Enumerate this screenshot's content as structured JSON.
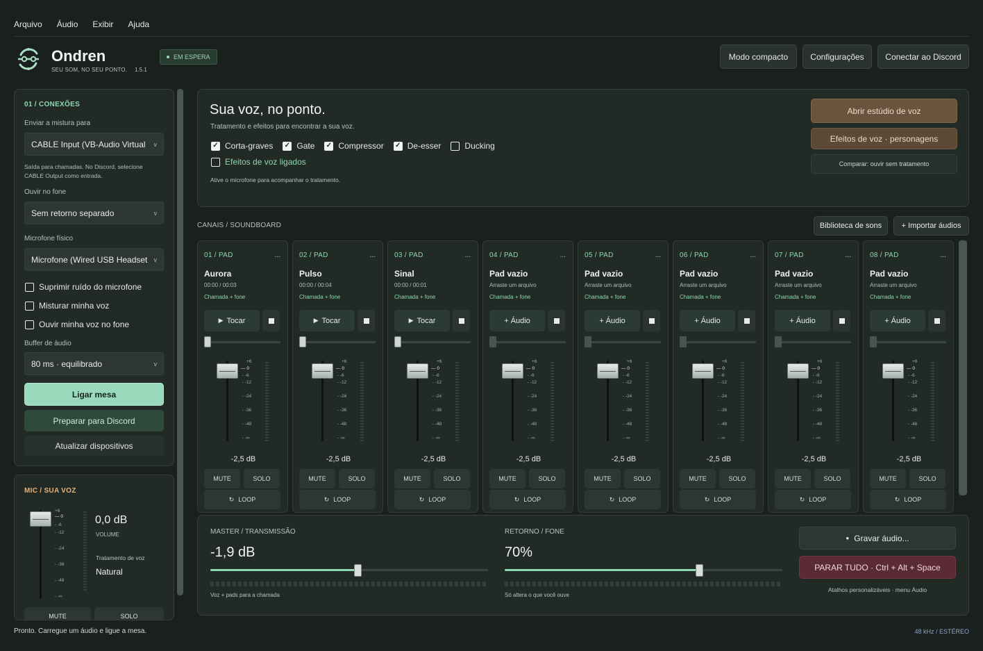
{
  "menu": [
    "Arquivo",
    "Áudio",
    "Exibir",
    "Ajuda"
  ],
  "app": {
    "name": "Ondren",
    "tagline": "SEU SOM, NO SEU PONTO.",
    "version": "1.5.1",
    "status": "EM ESPERA"
  },
  "header_buttons": {
    "compact": "Modo compacto",
    "settings": "Configurações",
    "discord": "Conectar ao Discord"
  },
  "connections": {
    "title": "01 / CONEXÕES",
    "send_label": "Enviar a mistura para",
    "send_value": "CABLE Input (VB-Audio Virtual (",
    "send_note_1": "Saída para chamadas. No Discord, selecione",
    "send_note_2": "CABLE Output como entrada.",
    "monitor_label": "Ouvir no fone",
    "monitor_value": "Sem retorno separado",
    "mic_label": "Microfone físico",
    "mic_value": "Microfone (Wired USB Headset",
    "options": [
      "Suprimir ruído do microfone",
      "Misturar minha voz",
      "Ouvir minha voz no fone"
    ],
    "buffer_label": "Buffer de áudio",
    "buffer_value": "80 ms · equilibrado",
    "start": "Ligar mesa",
    "prepare": "Preparar para Discord",
    "refresh": "Atualizar dispositivos"
  },
  "mic": {
    "title": "MIC / SUA VOZ",
    "db": "0,0 dB",
    "volume_label": "VOLUME",
    "treatment_label": "Tratamento de voz",
    "treatment_value": "Natural",
    "mute": "MUTE",
    "solo": "SOLO",
    "scale": [
      "+6",
      "0",
      "-6",
      "-12",
      "-24",
      "-36",
      "-48",
      "-∞"
    ]
  },
  "voice": {
    "title": "Sua voz, no ponto.",
    "subtitle": "Tratamento e efeitos para encontrar a sua voz.",
    "effects": [
      {
        "label": "Corta-graves",
        "checked": true
      },
      {
        "label": "Gate",
        "checked": true
      },
      {
        "label": "Compressor",
        "checked": true
      },
      {
        "label": "De-esser",
        "checked": true
      },
      {
        "label": "Ducking",
        "checked": false
      }
    ],
    "fx_toggle": "Efeitos de voz ligados",
    "hint": "Ative o microfone para acompanhar o tratamento.",
    "studio": "Abrir estúdio de voz",
    "characters": "Efeitos de voz · personagens",
    "compare": "Comparar: ouvir sem tratamento"
  },
  "channels": {
    "title": "CANAIS / SOUNDBOARD",
    "library": "Biblioteca de sons",
    "import": "+ Importar áudios",
    "scale": [
      "+6",
      "0",
      "-6",
      "-12",
      "-24",
      "-36",
      "-48",
      "-∞"
    ],
    "pads": [
      {
        "num": "01  /  PAD",
        "name": "Aurora",
        "time": "00:00 / 00:03",
        "route": "Chamada + fone",
        "action": "Tocar",
        "db": "-2,5 dB",
        "empty": false
      },
      {
        "num": "02  /  PAD",
        "name": "Pulso",
        "time": "00:00 / 00:04",
        "route": "Chamada + fone",
        "action": "Tocar",
        "db": "-2,5 dB",
        "empty": false
      },
      {
        "num": "03  /  PAD",
        "name": "Sinal",
        "time": "00:00 / 00:01",
        "route": "Chamada + fone",
        "action": "Tocar",
        "db": "-2,5 dB",
        "empty": false
      },
      {
        "num": "04  /  PAD",
        "name": "Pad vazio",
        "time": "Arraste um arquivo",
        "route": "Chamada + fone",
        "action": "+ Áudio",
        "db": "-2,5 dB",
        "empty": true
      },
      {
        "num": "05  /  PAD",
        "name": "Pad vazio",
        "time": "Arraste um arquivo",
        "route": "Chamada + fone",
        "action": "+ Áudio",
        "db": "-2,5 dB",
        "empty": true
      },
      {
        "num": "06  /  PAD",
        "name": "Pad vazio",
        "time": "Arraste um arquivo",
        "route": "Chamada + fone",
        "action": "+ Áudio",
        "db": "-2,5 dB",
        "empty": true
      },
      {
        "num": "07  /  PAD",
        "name": "Pad vazio",
        "time": "Arraste um arquivo",
        "route": "Chamada + fone",
        "action": "+ Áudio",
        "db": "-2,5 dB",
        "empty": true
      },
      {
        "num": "08  /  PAD",
        "name": "Pad vazio",
        "time": "Arraste um arquivo",
        "route": "Chamada + fone",
        "action": "+ Áudio",
        "db": "-2,5 dB",
        "empty": true
      }
    ],
    "mute": "MUTE",
    "solo": "SOLO",
    "loop": "LOOP",
    "dots": "..."
  },
  "master": {
    "label": "MASTER / TRANSMISSÃO",
    "value": "-1,9 dB",
    "level": 0.53,
    "note": "Voz + pads para a chamada"
  },
  "monitor": {
    "label": "RETORNO / FONE",
    "value": "70%",
    "level": 0.7,
    "note": "Só altera o que você ouve"
  },
  "actions": {
    "record": "Gravar áudio...",
    "stop_all": "PARAR TUDO · Ctrl + Alt + Space",
    "shortcuts": "Atalhos personalizáveis · menu Áudio"
  },
  "statusbar": {
    "message": "Pronto. Carregue um áudio e ligue a mesa.",
    "format": "48 kHz / ESTÉREO"
  },
  "colors": {
    "accent": "#8fd6b3",
    "background": "#1a201d",
    "panel": "#222a26",
    "danger": "#5a2a35",
    "voice_button": "#6b533d"
  }
}
